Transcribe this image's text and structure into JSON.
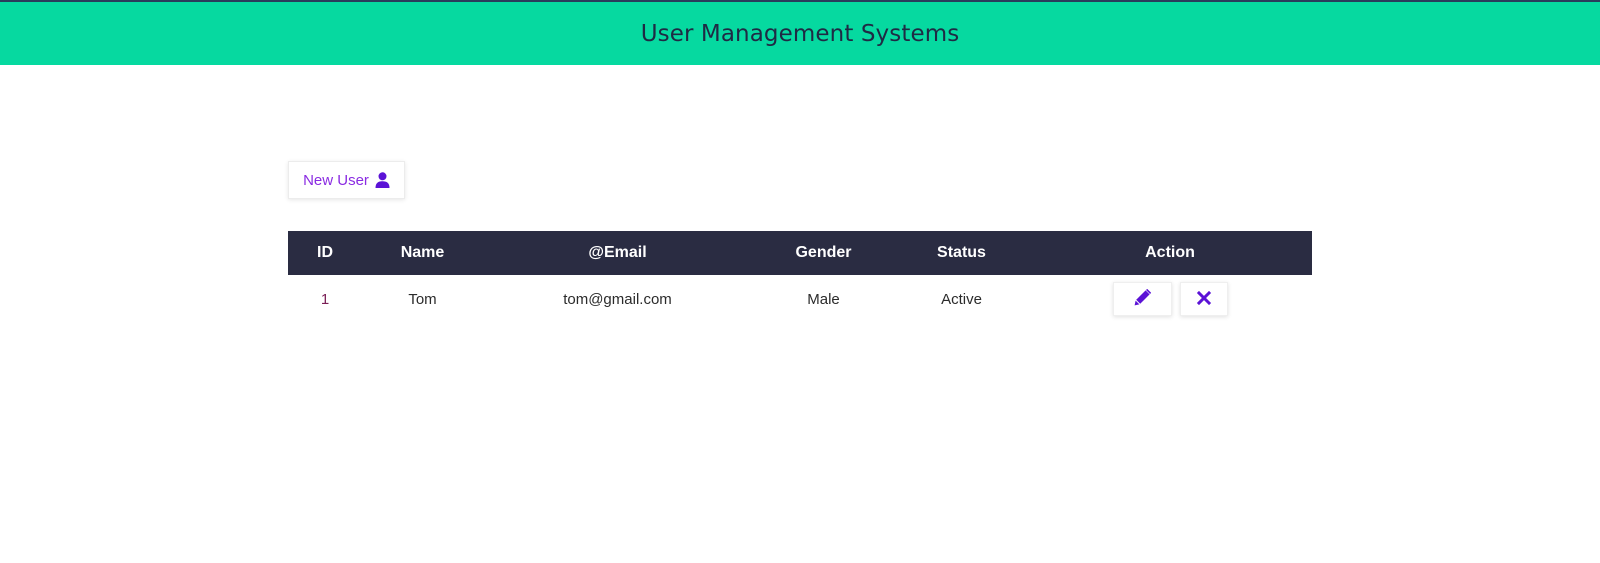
{
  "header": {
    "title": "User Management Systems",
    "bg_color": "#06d9a0"
  },
  "toolbar": {
    "new_user_label": "New User",
    "new_user_icon": "user-icon",
    "accent_color": "#8a2be2"
  },
  "table": {
    "columns": [
      "ID",
      "Name",
      "@Email",
      "Gender",
      "Status",
      "Action"
    ],
    "header_bg": "#2a2c42",
    "rows": [
      {
        "id": "1",
        "name": "Tom",
        "email": "tom@gmail.com",
        "gender": "Male",
        "status": "Active",
        "actions": [
          "pencil-icon",
          "close-icon"
        ]
      }
    ]
  }
}
